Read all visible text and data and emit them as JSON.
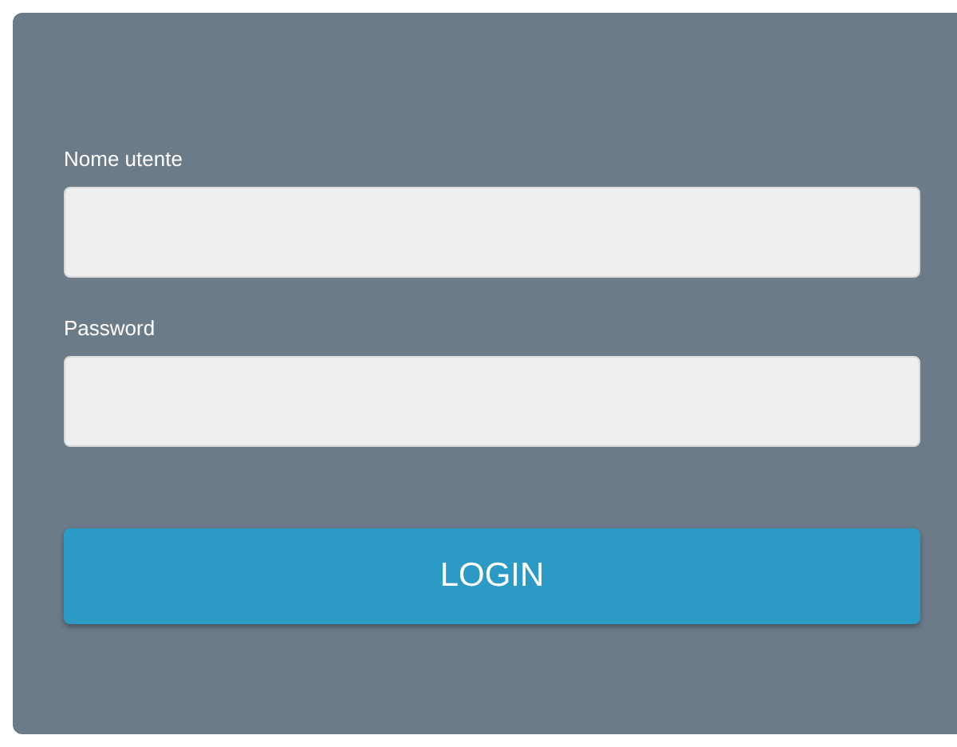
{
  "fields": [
    {
      "label": "Nome utente"
    },
    {
      "label": "Password"
    }
  ],
  "button": {
    "label": "LOGIN"
  }
}
